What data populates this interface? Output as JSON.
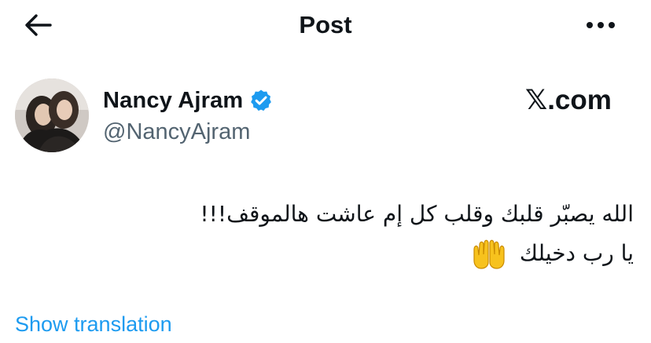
{
  "header": {
    "title": "Post",
    "back_icon": "arrow-left-icon",
    "more_icon": "more-horizontal-icon"
  },
  "author": {
    "name": "Nancy Ajram",
    "handle": "@NancyAjram",
    "verified": true,
    "verified_color": "#1d9bf0",
    "avatar": "profile-photo"
  },
  "watermark": "𝕏.com",
  "tweet": {
    "line1": "الله يصبّر قلبك وقلب كل إم عاشت هالموقف!!!",
    "line2": "يا رب دخيلك",
    "emoji": "🤲"
  },
  "translate_label": "Show translation",
  "colors": {
    "link": "#1d9bf0",
    "secondary_text": "#536471",
    "primary_text": "#0f1419"
  }
}
